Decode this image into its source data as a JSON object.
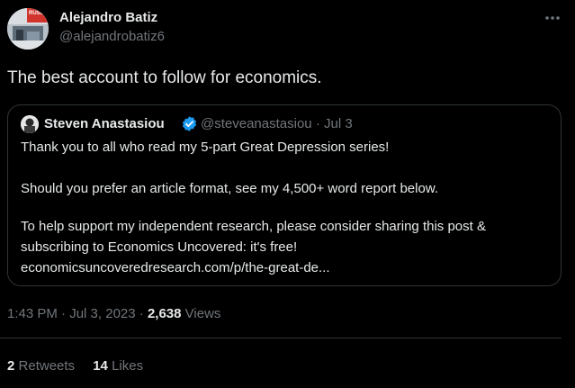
{
  "tweet": {
    "author_name": "Alejandro Batiz",
    "author_handle": "@alejandrobatiz6",
    "avatar_badge_text": "RUSSI",
    "text": "The best account to follow for economics.",
    "more_icon": "more-horizontal-icon"
  },
  "quote": {
    "author_name": "Steven Anastasiou",
    "author_handle": "@steveanastasiou",
    "separator": "·",
    "date": "Jul 3",
    "verified_icon": "verified-badge-icon",
    "lines": {
      "l1": "Thank you to all who read my 5-part Great Depression series!",
      "l2": "Should you prefer an article format, see my 4,500+ word report below.",
      "l3": "To help support my independent research, please consider sharing this post &",
      "l4": "subscribing to Economics Uncovered: it's free!",
      "l5": "economicsuncoveredresearch.com/p/the-great-de..."
    }
  },
  "meta": {
    "time": "1:43 PM",
    "sep1": "·",
    "date": "Jul 3, 2023",
    "sep2": "·",
    "views_count": "2,638",
    "views_label": "Views"
  },
  "engagement": {
    "retweets_count": "2",
    "retweets_label": "Retweets",
    "likes_count": "14",
    "likes_label": "Likes"
  },
  "colors": {
    "background": "#000000",
    "text_primary": "#e7e9ea",
    "text_secondary": "#71767b",
    "border": "#2f3336",
    "verified": "#1d9bf0"
  }
}
